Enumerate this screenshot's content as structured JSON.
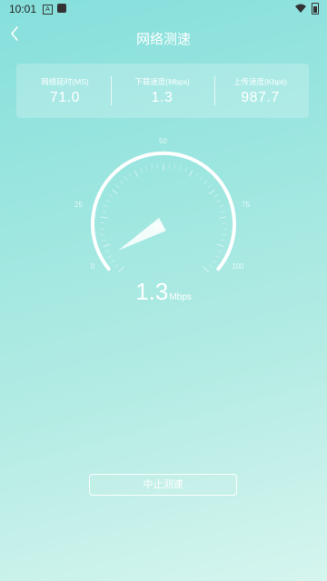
{
  "status_bar": {
    "time": "10:01",
    "app_icon_letter": "A",
    "icons": [
      "notification-square-icon",
      "wifi-icon",
      "battery-icon"
    ]
  },
  "header": {
    "title": "网络测速",
    "back_icon": "chevron-left-icon"
  },
  "stats": {
    "latency": {
      "label": "网络延时(MS)",
      "value": "71.0"
    },
    "download": {
      "label": "下载速度(Mbps)",
      "value": "1.3"
    },
    "upload": {
      "label": "上传速度(Kbps)",
      "value": "987.7"
    }
  },
  "gauge": {
    "ticks": {
      "t0": "0",
      "t25": "25",
      "t50": "50",
      "t75": "75",
      "t100": "100"
    },
    "min": 0,
    "max": 100,
    "needle_value": 1.3
  },
  "speed": {
    "value": "1.3",
    "unit": "Mbps"
  },
  "actions": {
    "stop_label": "中止测速"
  },
  "colors": {
    "background_top": "#86dfdc",
    "background_bottom": "#d6f5ef",
    "text": "#ffffff"
  }
}
